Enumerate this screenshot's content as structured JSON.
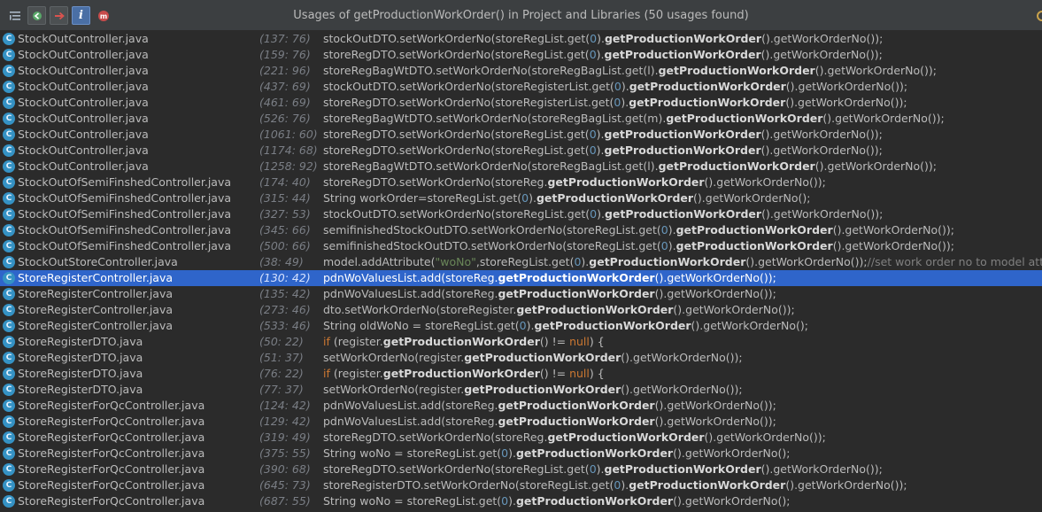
{
  "window": {
    "title": "Usages of getProductionWorkOrder() in Project and Libraries (50 usages found)"
  },
  "toolbar": {
    "icons": [
      "expand-icon",
      "previous-usage-icon",
      "next-usage-icon",
      "info-icon",
      "method-icon"
    ]
  },
  "colors": {
    "background": "#2b2b2b",
    "selection": "#2f65ca",
    "class_icon": "#3592c4",
    "number": "#6897bb",
    "keyword": "#cc7832",
    "string": "#6a8759"
  },
  "rows": [
    {
      "file": "StockOutController.java",
      "loc": "(137: 76)",
      "code": [
        {
          "t": "stockOutDTO.setWorkOrderNo(storeRegList.get("
        },
        {
          "t": "0",
          "c": "num"
        },
        {
          "t": ")."
        },
        {
          "t": "getProductionWorkOrder",
          "c": "b"
        },
        {
          "t": "().getWorkOrderNo());"
        }
      ]
    },
    {
      "file": "StockOutController.java",
      "loc": "(159: 76)",
      "code": [
        {
          "t": "storeRegDTO.setWorkOrderNo(storeRegList.get("
        },
        {
          "t": "0",
          "c": "num"
        },
        {
          "t": ")."
        },
        {
          "t": "getProductionWorkOrder",
          "c": "b"
        },
        {
          "t": "().getWorkOrderNo());"
        }
      ]
    },
    {
      "file": "StockOutController.java",
      "loc": "(221: 96)",
      "code": [
        {
          "t": "storeRegBagWtDTO.setWorkOrderNo(storeRegBagList.get(l)."
        },
        {
          "t": "getProductionWorkOrder",
          "c": "b"
        },
        {
          "t": "().getWorkOrderNo());"
        }
      ]
    },
    {
      "file": "StockOutController.java",
      "loc": "(437: 69)",
      "code": [
        {
          "t": "stockOutDTO.setWorkOrderNo(storeRegisterList.get("
        },
        {
          "t": "0",
          "c": "num"
        },
        {
          "t": ")."
        },
        {
          "t": "getProductionWorkOrder",
          "c": "b"
        },
        {
          "t": "().getWorkOrderNo());"
        }
      ]
    },
    {
      "file": "StockOutController.java",
      "loc": "(461: 69)",
      "code": [
        {
          "t": "storeRegDTO.setWorkOrderNo(storeRegisterList.get("
        },
        {
          "t": "0",
          "c": "num"
        },
        {
          "t": ")."
        },
        {
          "t": "getProductionWorkOrder",
          "c": "b"
        },
        {
          "t": "().getWorkOrderNo());"
        }
      ]
    },
    {
      "file": "StockOutController.java",
      "loc": "(526: 76)",
      "code": [
        {
          "t": "storeRegBagWtDTO.setWorkOrderNo(storeRegBagList.get(m)."
        },
        {
          "t": "getProductionWorkOrder",
          "c": "b"
        },
        {
          "t": "().getWorkOrderNo());"
        }
      ]
    },
    {
      "file": "StockOutController.java",
      "loc": "(1061: 60)",
      "code": [
        {
          "t": "storeRegDTO.setWorkOrderNo(storeRegList.get("
        },
        {
          "t": "0",
          "c": "num"
        },
        {
          "t": ")."
        },
        {
          "t": "getProductionWorkOrder",
          "c": "b"
        },
        {
          "t": "().getWorkOrderNo());"
        }
      ]
    },
    {
      "file": "StockOutController.java",
      "loc": "(1174: 68)",
      "code": [
        {
          "t": "storeRegDTO.setWorkOrderNo(storeRegList.get("
        },
        {
          "t": "0",
          "c": "num"
        },
        {
          "t": ")."
        },
        {
          "t": "getProductionWorkOrder",
          "c": "b"
        },
        {
          "t": "().getWorkOrderNo());"
        }
      ]
    },
    {
      "file": "StockOutController.java",
      "loc": "(1258: 92)",
      "code": [
        {
          "t": "storeRegBagWtDTO.setWorkOrderNo(storeRegBagList.get(l)."
        },
        {
          "t": "getProductionWorkOrder",
          "c": "b"
        },
        {
          "t": "().getWorkOrderNo());"
        }
      ]
    },
    {
      "file": "StockOutOfSemiFinshedController.java",
      "loc": "(174: 40)",
      "code": [
        {
          "t": "storeRegDTO.setWorkOrderNo(storeReg."
        },
        {
          "t": "getProductionWorkOrder",
          "c": "b"
        },
        {
          "t": "().getWorkOrderNo());"
        }
      ]
    },
    {
      "file": "StockOutOfSemiFinshedController.java",
      "loc": "(315: 44)",
      "code": [
        {
          "t": "String workOrder=storeRegList.get("
        },
        {
          "t": "0",
          "c": "num"
        },
        {
          "t": ")."
        },
        {
          "t": "getProductionWorkOrder",
          "c": "b"
        },
        {
          "t": "().getWorkOrderNo();"
        }
      ]
    },
    {
      "file": "StockOutOfSemiFinshedController.java",
      "loc": "(327: 53)",
      "code": [
        {
          "t": "stockOutDTO.setWorkOrderNo(storeRegList.get("
        },
        {
          "t": "0",
          "c": "num"
        },
        {
          "t": ")."
        },
        {
          "t": "getProductionWorkOrder",
          "c": "b"
        },
        {
          "t": "().getWorkOrderNo());"
        }
      ]
    },
    {
      "file": "StockOutOfSemiFinshedController.java",
      "loc": "(345: 66)",
      "code": [
        {
          "t": "semifinishedStockOutDTO.setWorkOrderNo(storeRegList.get("
        },
        {
          "t": "0",
          "c": "num"
        },
        {
          "t": ")."
        },
        {
          "t": "getProductionWorkOrder",
          "c": "b"
        },
        {
          "t": "().getWorkOrderNo());"
        }
      ]
    },
    {
      "file": "StockOutOfSemiFinshedController.java",
      "loc": "(500: 66)",
      "code": [
        {
          "t": "semifinishedStockOutDTO.setWorkOrderNo(storeRegList.get("
        },
        {
          "t": "0",
          "c": "num"
        },
        {
          "t": ")."
        },
        {
          "t": "getProductionWorkOrder",
          "c": "b"
        },
        {
          "t": "().getWorkOrderNo());"
        }
      ]
    },
    {
      "file": "StockOutStoreController.java",
      "loc": "(38: 49)",
      "code": [
        {
          "t": "model.addAttribute("
        },
        {
          "t": "\"woNo\"",
          "c": "str"
        },
        {
          "t": ",storeRegList.get("
        },
        {
          "t": "0",
          "c": "num"
        },
        {
          "t": ")."
        },
        {
          "t": "getProductionWorkOrder",
          "c": "b"
        },
        {
          "t": "().getWorkOrderNo());"
        },
        {
          "t": "//set work order no to model att",
          "c": "cmt"
        }
      ]
    },
    {
      "file": "StoreRegisterController.java",
      "loc": "(130: 42)",
      "selected": true,
      "code": [
        {
          "t": "pdnWoValuesList.add(storeReg."
        },
        {
          "t": "getProductionWorkOrder",
          "c": "b"
        },
        {
          "t": "().getWorkOrderNo());"
        }
      ]
    },
    {
      "file": "StoreRegisterController.java",
      "loc": "(135: 42)",
      "code": [
        {
          "t": "pdnWoValuesList.add(storeReg."
        },
        {
          "t": "getProductionWorkOrder",
          "c": "b"
        },
        {
          "t": "().getWorkOrderNo());"
        }
      ]
    },
    {
      "file": "StoreRegisterController.java",
      "loc": "(273: 46)",
      "code": [
        {
          "t": "dto.setWorkOrderNo(storeRegister."
        },
        {
          "t": "getProductionWorkOrder",
          "c": "b"
        },
        {
          "t": "().getWorkOrderNo());"
        }
      ]
    },
    {
      "file": "StoreRegisterController.java",
      "loc": "(533: 46)",
      "code": [
        {
          "t": "String oldWoNo = storeRegList.get("
        },
        {
          "t": "0",
          "c": "num"
        },
        {
          "t": ")."
        },
        {
          "t": "getProductionWorkOrder",
          "c": "b"
        },
        {
          "t": "().getWorkOrderNo();"
        }
      ]
    },
    {
      "file": "StoreRegisterDTO.java",
      "loc": "(50: 22)",
      "code": [
        {
          "t": "if",
          "c": "kw"
        },
        {
          "t": " (register."
        },
        {
          "t": "getProductionWorkOrder",
          "c": "b"
        },
        {
          "t": "() != "
        },
        {
          "t": "null",
          "c": "kw"
        },
        {
          "t": ") {"
        }
      ]
    },
    {
      "file": "StoreRegisterDTO.java",
      "loc": "(51: 37)",
      "code": [
        {
          "t": "setWorkOrderNo(register."
        },
        {
          "t": "getProductionWorkOrder",
          "c": "b"
        },
        {
          "t": "().getWorkOrderNo());"
        }
      ]
    },
    {
      "file": "StoreRegisterDTO.java",
      "loc": "(76: 22)",
      "code": [
        {
          "t": "if",
          "c": "kw"
        },
        {
          "t": " (register."
        },
        {
          "t": "getProductionWorkOrder",
          "c": "b"
        },
        {
          "t": "() != "
        },
        {
          "t": "null",
          "c": "kw"
        },
        {
          "t": ") {"
        }
      ]
    },
    {
      "file": "StoreRegisterDTO.java",
      "loc": "(77: 37)",
      "code": [
        {
          "t": "setWorkOrderNo(register."
        },
        {
          "t": "getProductionWorkOrder",
          "c": "b"
        },
        {
          "t": "().getWorkOrderNo());"
        }
      ]
    },
    {
      "file": "StoreRegisterForQcController.java",
      "loc": "(124: 42)",
      "code": [
        {
          "t": "pdnWoValuesList.add(storeReg."
        },
        {
          "t": "getProductionWorkOrder",
          "c": "b"
        },
        {
          "t": "().getWorkOrderNo());"
        }
      ]
    },
    {
      "file": "StoreRegisterForQcController.java",
      "loc": "(129: 42)",
      "code": [
        {
          "t": "pdnWoValuesList.add(storeReg."
        },
        {
          "t": "getProductionWorkOrder",
          "c": "b"
        },
        {
          "t": "().getWorkOrderNo());"
        }
      ]
    },
    {
      "file": "StoreRegisterForQcController.java",
      "loc": "(319: 49)",
      "code": [
        {
          "t": "storeRegDTO.setWorkOrderNo(storeReg."
        },
        {
          "t": "getProductionWorkOrder",
          "c": "b"
        },
        {
          "t": "().getWorkOrderNo());"
        }
      ]
    },
    {
      "file": "StoreRegisterForQcController.java",
      "loc": "(375: 55)",
      "code": [
        {
          "t": "String woNo = storeRegList.get("
        },
        {
          "t": "0",
          "c": "num"
        },
        {
          "t": ")."
        },
        {
          "t": "getProductionWorkOrder",
          "c": "b"
        },
        {
          "t": "().getWorkOrderNo();"
        }
      ]
    },
    {
      "file": "StoreRegisterForQcController.java",
      "loc": "(390: 68)",
      "code": [
        {
          "t": "storeRegDTO.setWorkOrderNo(storeRegList.get("
        },
        {
          "t": "0",
          "c": "num"
        },
        {
          "t": ")."
        },
        {
          "t": "getProductionWorkOrder",
          "c": "b"
        },
        {
          "t": "().getWorkOrderNo());"
        }
      ]
    },
    {
      "file": "StoreRegisterForQcController.java",
      "loc": "(645: 73)",
      "code": [
        {
          "t": "storeRegisterDTO.setWorkOrderNo(storeRegList.get("
        },
        {
          "t": "0",
          "c": "num"
        },
        {
          "t": ")."
        },
        {
          "t": "getProductionWorkOrder",
          "c": "b"
        },
        {
          "t": "().getWorkOrderNo());"
        }
      ]
    },
    {
      "file": "StoreRegisterForQcController.java",
      "loc": "(687: 55)",
      "code": [
        {
          "t": "String woNo = storeRegList.get("
        },
        {
          "t": "0",
          "c": "num"
        },
        {
          "t": ")."
        },
        {
          "t": "getProductionWorkOrder",
          "c": "b"
        },
        {
          "t": "().getWorkOrderNo();"
        }
      ]
    }
  ]
}
